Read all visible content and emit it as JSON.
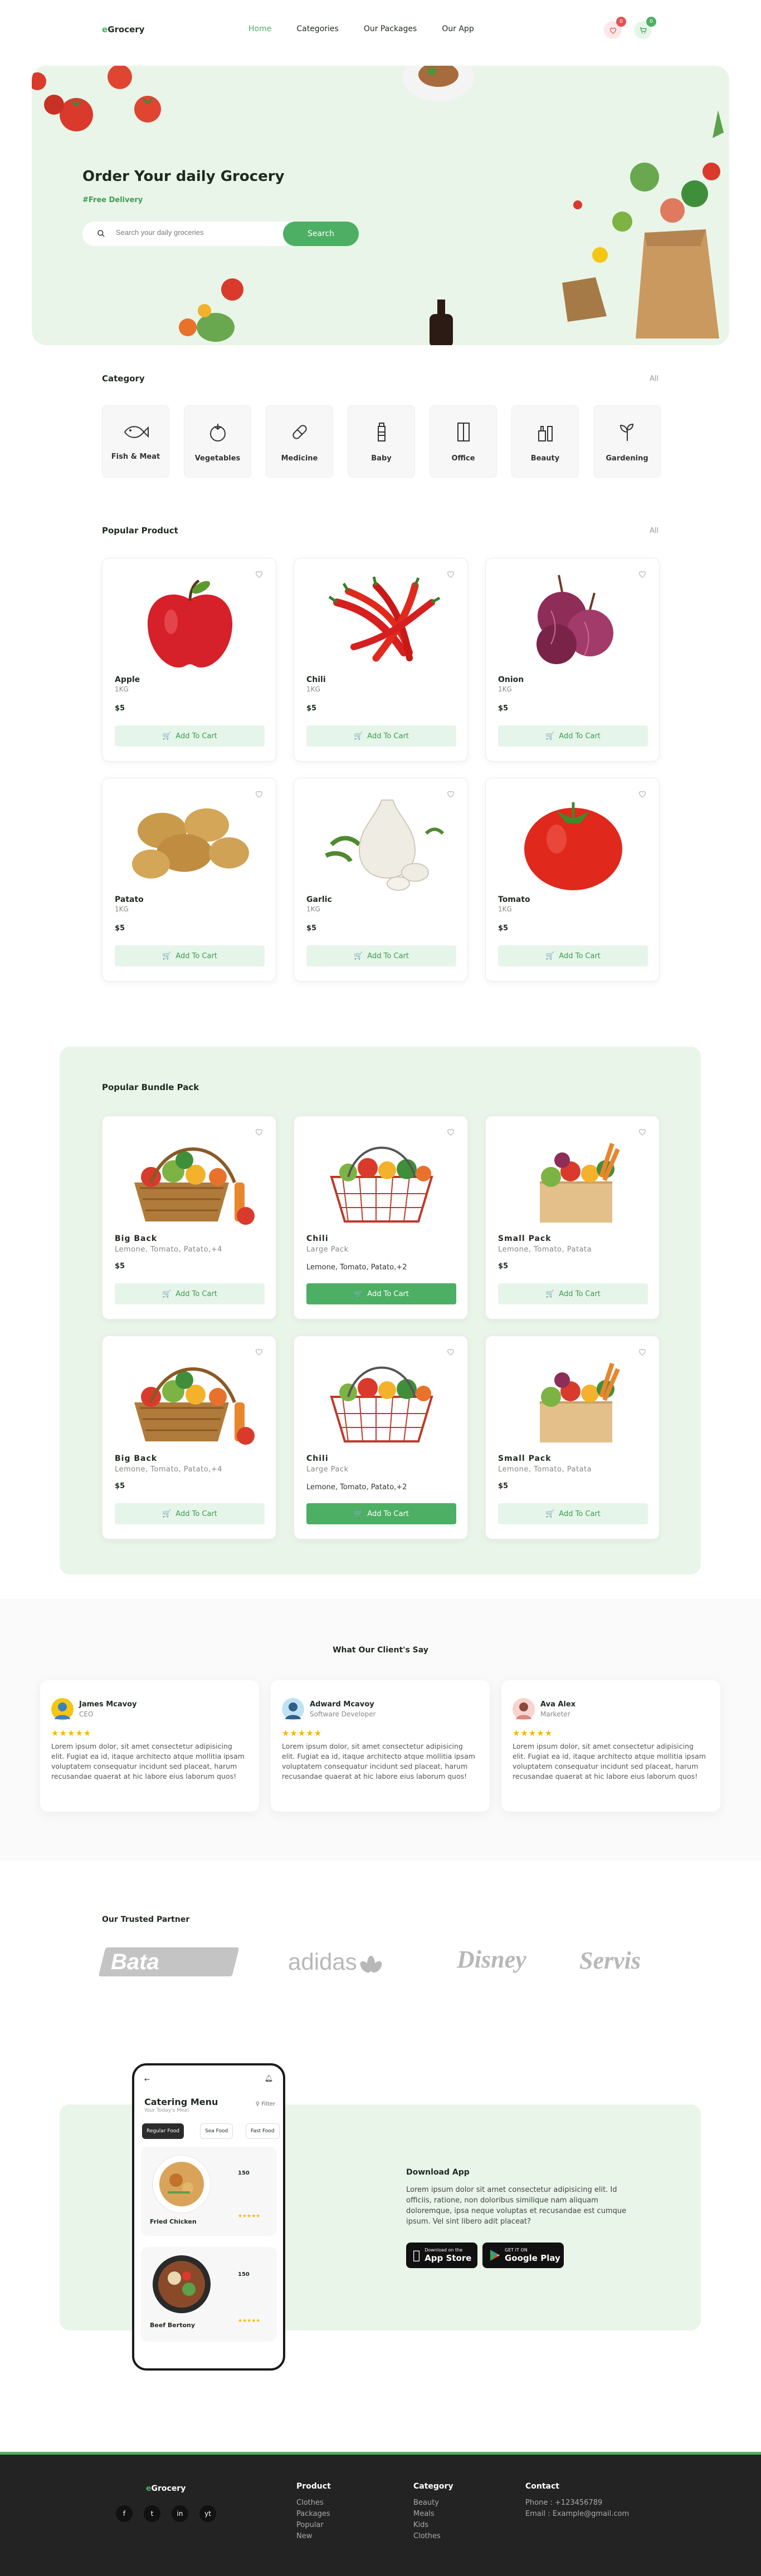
{
  "header": {
    "logo_prefix": "e",
    "logo_main": "Grocery",
    "nav": [
      "Home",
      "Categories",
      "Our Packages",
      "Our App"
    ],
    "wishlist_count": "0",
    "cart_count": "0"
  },
  "hero": {
    "title": "Order Your daily Grocery",
    "subtitle": "#Free Delivery",
    "search_placeholder": "Search your daily groceries",
    "search_button": "Search"
  },
  "category": {
    "title": "Category",
    "all_label": "All",
    "items": [
      "Fish & Meat",
      "Vegetables",
      "Medicine",
      "Baby",
      "Office",
      "Beauty",
      "Gardening"
    ]
  },
  "popular": {
    "title": "Popular Product",
    "all_label": "All",
    "products": [
      {
        "name": "Apple",
        "weight": "1KG",
        "price": "$5",
        "button": "Add To Cart"
      },
      {
        "name": "Chili",
        "weight": "1KG",
        "price": "$5",
        "button": "Add To Cart"
      },
      {
        "name": "Onion",
        "weight": "1KG",
        "price": "$5",
        "button": "Add To Cart"
      },
      {
        "name": "Patato",
        "weight": "1KG",
        "price": "$5",
        "button": "Add To Cart"
      },
      {
        "name": "Garlic",
        "weight": "1KG",
        "price": "$5",
        "button": "Add To Cart"
      },
      {
        "name": "Tomato",
        "weight": "1KG",
        "price": "$5",
        "button": "Add To Cart"
      }
    ]
  },
  "bundles": {
    "title": "Popular Bundle Pack",
    "items": [
      {
        "name": "Big Back",
        "contents": "Lemone, Tomato, Patato,+4",
        "price": "$5",
        "button": "Add To Cart"
      },
      {
        "name": "Chili",
        "subtitle": "Large Pack",
        "contents": "Lemone, Tomato, Patato,+2",
        "button": "Add To Cart"
      },
      {
        "name": "Small Pack",
        "contents": "Lemone, Tomato, Patata",
        "price": "$5",
        "button": "Add To Cart"
      },
      {
        "name": "Big Back",
        "contents": "Lemone, Tomato, Patato,+4",
        "price": "$5",
        "button": "Add To Cart"
      },
      {
        "name": "Chili",
        "subtitle": "Large Pack",
        "contents": "Lemone, Tomato, Patato,+2",
        "button": "Add To Cart"
      },
      {
        "name": "Small Pack",
        "contents": "Lemone, Tomato, Patata",
        "price": "$5",
        "button": "Add To Cart"
      }
    ]
  },
  "testimonials": {
    "title": "What Our Client's Say",
    "items": [
      {
        "name": "James Mcavoy",
        "role": "CEO",
        "stars": "★★★★★",
        "text": "Lorem ipsum dolor, sit amet consectetur adipisicing elit. Fugiat ea id, itaque architecto atque mollitia ipsam voluptatem consequatur incidunt sed placeat, harum recusandae quaerat at hic labore eius laborum quos!"
      },
      {
        "name": "Adward Mcavoy",
        "role": "Software Developer",
        "stars": "★★★★★",
        "text": "Lorem ipsum dolor, sit amet consectetur adipisicing elit. Fugiat ea id, itaque architecto atque mollitia ipsam voluptatem consequatur incidunt sed placeat, harum recusandae quaerat at hic labore eius laborum quos!"
      },
      {
        "name": "Ava Alex",
        "role": "Marketer",
        "stars": "★★★★★",
        "text": "Lorem ipsum dolor, sit amet consectetur adipisicing elit. Fugiat ea id, itaque architecto atque mollitia ipsam voluptatem consequatur incidunt sed placeat, harum recusandae quaerat at hic labore eius laborum quos!"
      }
    ]
  },
  "partners": {
    "title": "Our Trusted Partner",
    "logos": [
      "Bata",
      "adidas",
      "Disney",
      "Servis"
    ]
  },
  "app": {
    "title": "Download App",
    "text": "Lorem ipsum dolor sit amet consectetur adipisicing elit. Id officiis, ratione, non doloribus similique nam aliquam doloremque, ipsa neque voluptas et recusandae est cumque ipsum. Vel sint libero adit placeat?",
    "appstore_small": "Download on the",
    "appstore_big": "App Store",
    "gplay_small": "GET IT ON",
    "gplay_big": "Google Play",
    "phone": {
      "title": "Catering Menu",
      "subtitle": "Your Today's Meal",
      "filter": "Filter",
      "chips": [
        "Regular Food",
        "Sea Food",
        "Fast Food"
      ],
      "dishes": [
        {
          "name": "Fried Chicken",
          "price": "150"
        },
        {
          "name": "Beef Bertony",
          "price": "150"
        }
      ]
    }
  },
  "footer": {
    "logo_prefix": "e",
    "logo_main": "Grocery",
    "social": [
      "f",
      "t",
      "in",
      "yt"
    ],
    "product_title": "Product",
    "product_links": [
      "Clothes",
      "Packages",
      "Popular",
      "New"
    ],
    "category_title": "Category",
    "category_links": [
      "Beauty",
      "Meals",
      "Kids",
      "Clothes"
    ],
    "contact_title": "Contact",
    "phone": "Phone : +123456789",
    "email": "Email : Example@gmail.com"
  },
  "colors": {
    "accent": "#4caf63",
    "hero_bg": "#e9f5e9",
    "footer_bg": "#232323"
  }
}
